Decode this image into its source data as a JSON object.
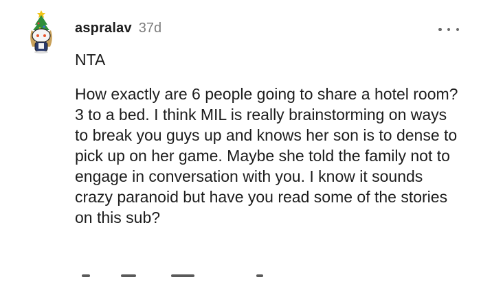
{
  "comment": {
    "username": "aspralav",
    "time": "37d",
    "paragraphs": [
      "NTA",
      "How exactly are 6 people going to share a hotel room? 3 to a bed. I think MIL is really brainstorming on ways to break you guys up and knows her son is to dense to pick up on her game. Maybe she told the family not to engage in conversation with you. I know it sounds crazy paranoid but have you read some of the stories on this sub?"
    ]
  },
  "icons": {
    "avatar": "snoo-avatar-with-christmas-tree-icon",
    "more": "more-options-icon"
  },
  "colors": {
    "text": "#1c1c1c",
    "muted": "#7c7c7c",
    "icon": "#6a6a6a",
    "background": "#ffffff"
  }
}
